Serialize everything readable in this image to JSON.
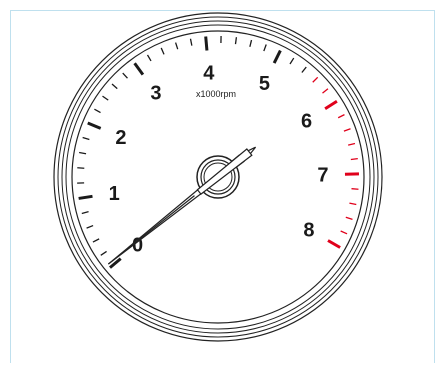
{
  "gauge": {
    "unit_label": "x1000rpm",
    "scale_min": 0,
    "scale_max": 8,
    "major_step": 1,
    "minor_divisions": 5,
    "redline_start": 5.5,
    "numerals": [
      "0",
      "1",
      "2",
      "3",
      "4",
      "5",
      "6",
      "7",
      "8"
    ],
    "needle_value": 0.05,
    "colors": {
      "tick": "#1a1a1a",
      "redline": "#e0001b",
      "rim": "#222222",
      "face": "#ffffff",
      "frame_border": "#bfe0ee"
    }
  }
}
